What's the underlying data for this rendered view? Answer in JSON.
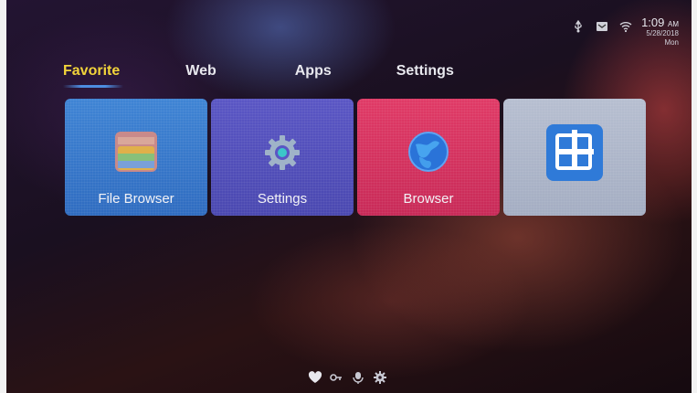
{
  "status": {
    "icons": [
      "usb-icon",
      "inbox-icon",
      "wifi-icon"
    ],
    "time": "1:09",
    "ampm": "AM",
    "date": "5/28/2018",
    "day": "Mon"
  },
  "tabs": [
    {
      "label": "Favorite",
      "active": true
    },
    {
      "label": "Web",
      "active": false
    },
    {
      "label": "Apps",
      "active": false
    },
    {
      "label": "Settings",
      "active": false
    }
  ],
  "tiles": [
    {
      "label": "File Browser",
      "icon": "folder-icon",
      "color": "#3f84d4"
    },
    {
      "label": "Settings",
      "icon": "gear-icon",
      "color": "#5a56c4"
    },
    {
      "label": "Browser",
      "icon": "globe-icon",
      "color": "#e03a66"
    },
    {
      "label": "",
      "icon": "add-icon",
      "color": "#b6bed0"
    }
  ],
  "bottom_icons": [
    "heart-icon",
    "key-icon",
    "microphone-icon",
    "settings-icon"
  ],
  "colors": {
    "active_tab": "#f2d43a",
    "tab_underline": "#4d8de0"
  }
}
